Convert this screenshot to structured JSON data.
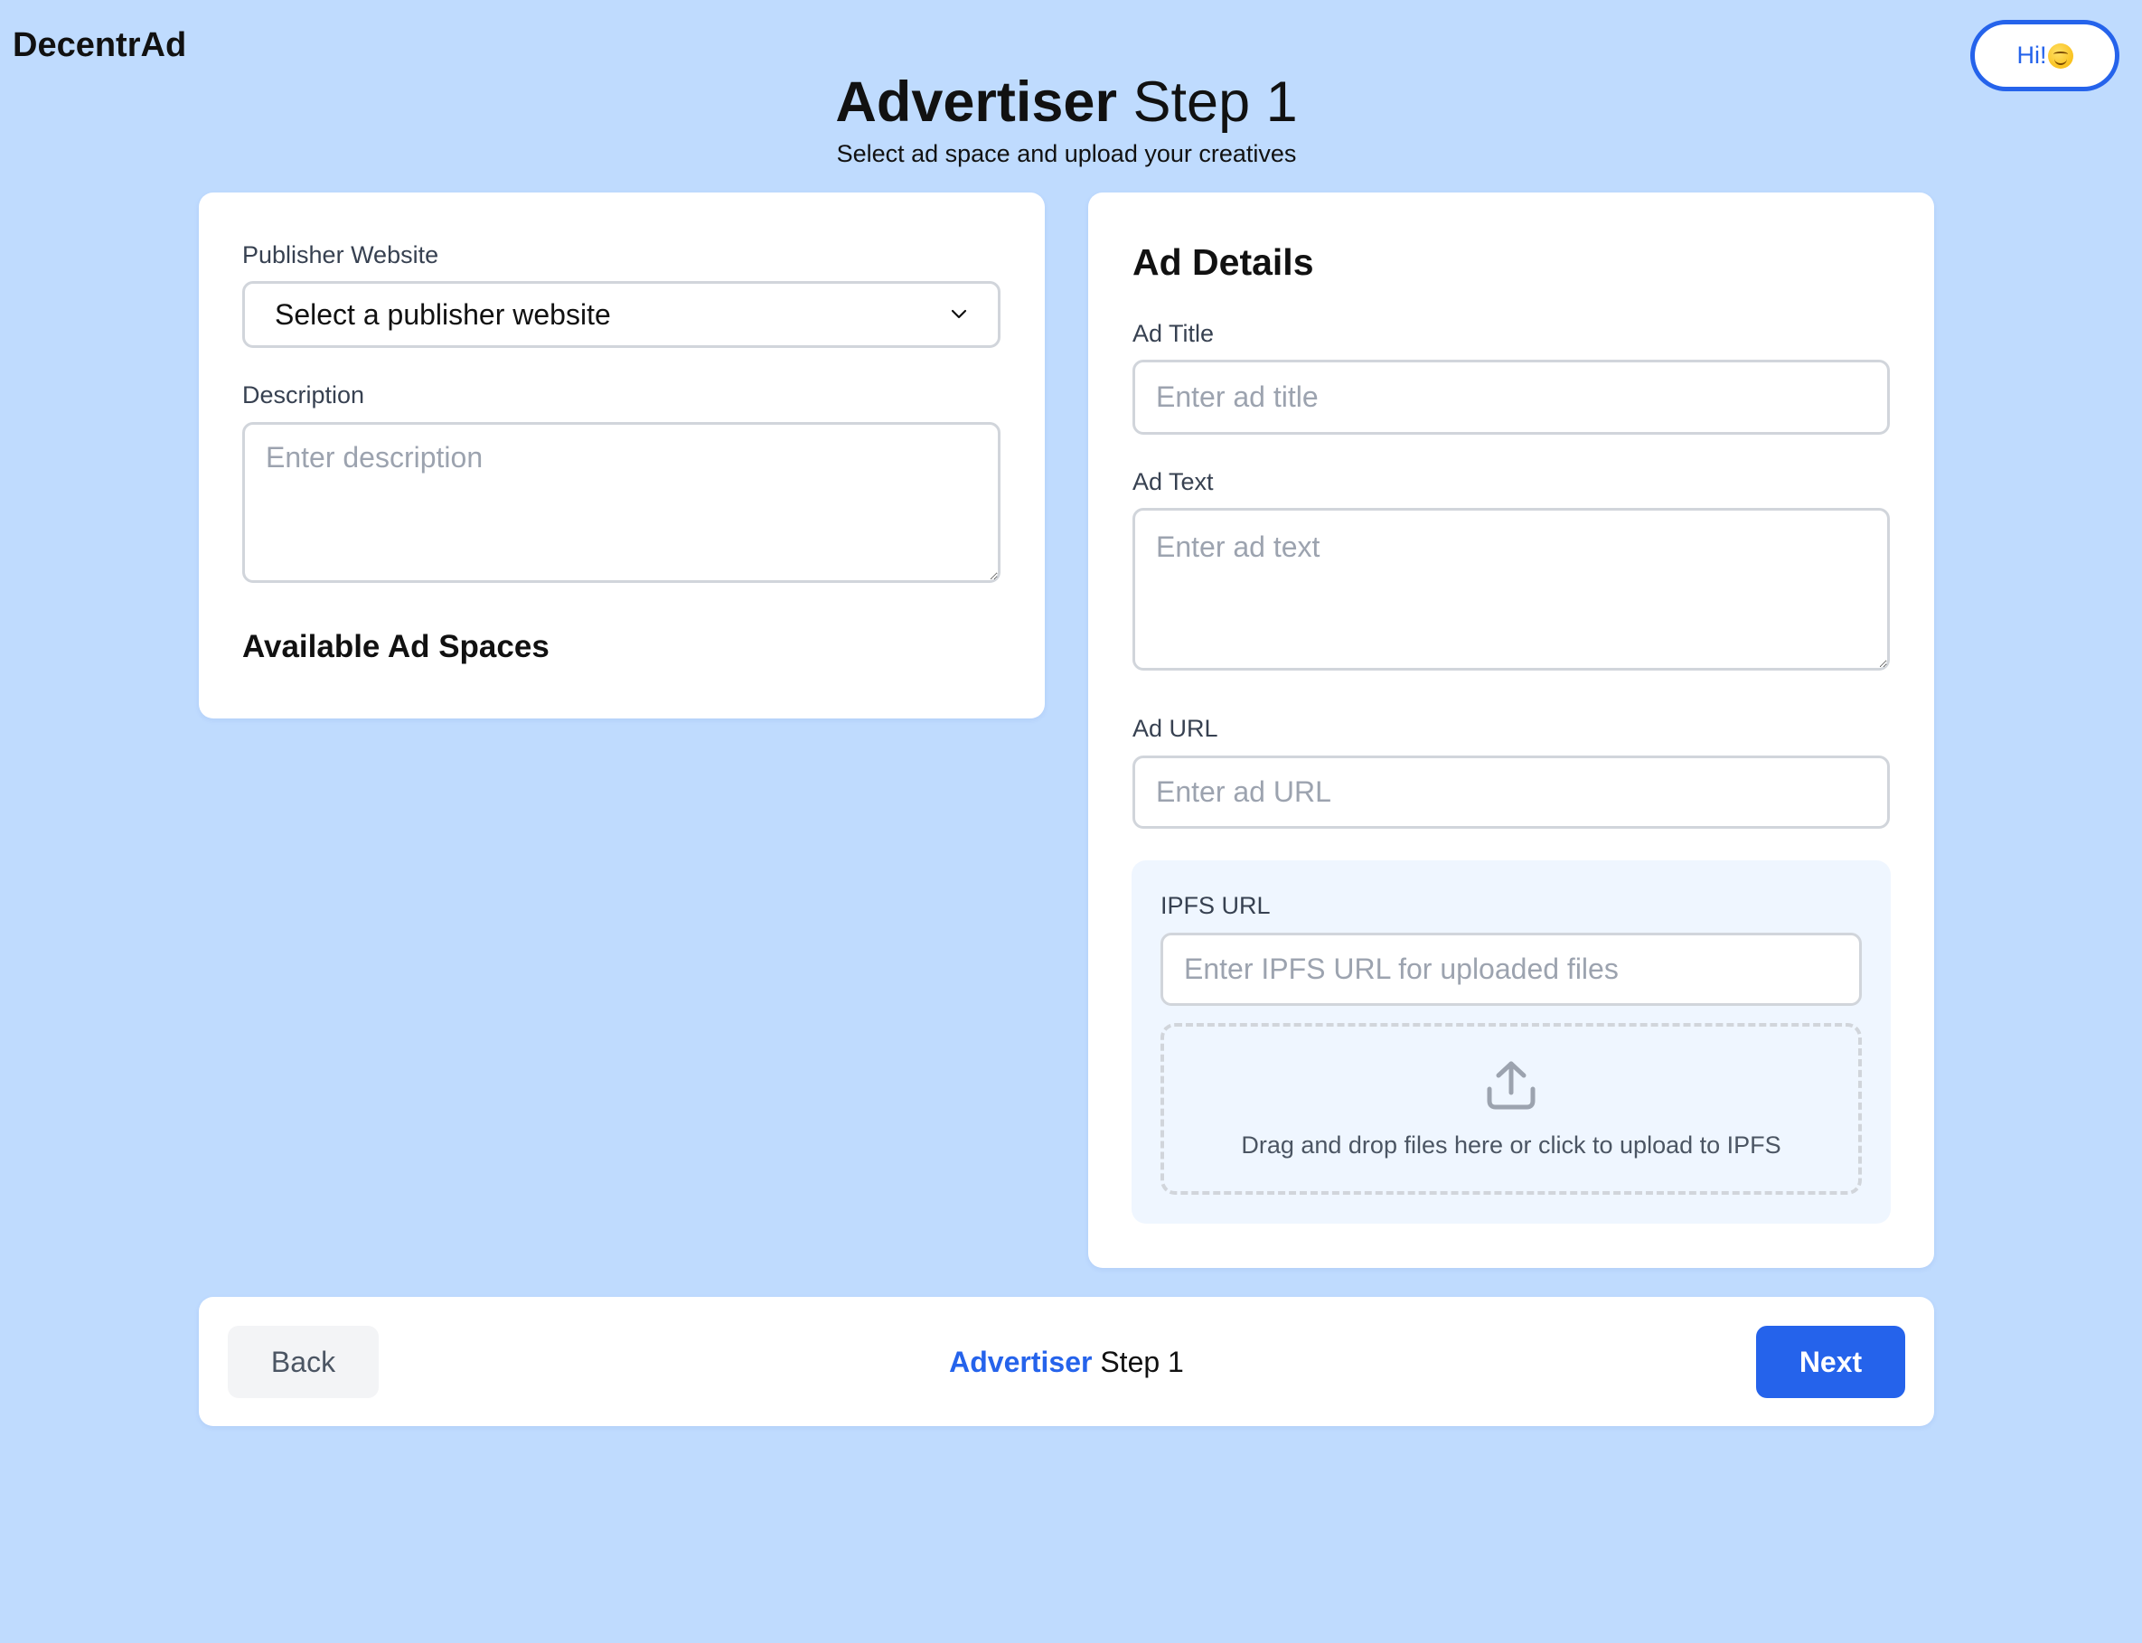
{
  "app": {
    "brand": "DecentrAd",
    "greeting_label": "Hi!",
    "greeting_emoji": "face-savoring-food"
  },
  "header": {
    "title_strong": "Advertiser",
    "title_rest": " Step 1",
    "subtitle": "Select ad space and upload your creatives"
  },
  "left_panel": {
    "publisher_label": "Publisher Website",
    "publisher_select_value": "Select a publisher website",
    "description_label": "Description",
    "description_placeholder": "Enter description",
    "description_value": "",
    "ad_spaces_heading": "Available Ad Spaces"
  },
  "right_panel": {
    "heading": "Ad Details",
    "ad_title_label": "Ad Title",
    "ad_title_placeholder": "Enter ad title",
    "ad_title_value": "",
    "ad_text_label": "Ad Text",
    "ad_text_placeholder": "Enter ad text",
    "ad_text_value": "",
    "ad_url_label": "Ad URL",
    "ad_url_placeholder": "Enter ad URL",
    "ad_url_value": "",
    "ipfs": {
      "label": "IPFS URL",
      "placeholder": "Enter IPFS URL for uploaded files",
      "value": "",
      "dropzone_text": "Drag and drop files here or click to upload to IPFS",
      "dropzone_icon": "upload-icon"
    }
  },
  "footer": {
    "back_label": "Back",
    "step_strong": "Advertiser",
    "step_rest": " Step 1",
    "next_label": "Next"
  },
  "colors": {
    "background": "#bfdbfe",
    "accent": "#2563eb",
    "card": "#ffffff",
    "ipfs_box": "#eff6ff",
    "input_border": "#d1d5db",
    "placeholder": "#9ca3af"
  }
}
